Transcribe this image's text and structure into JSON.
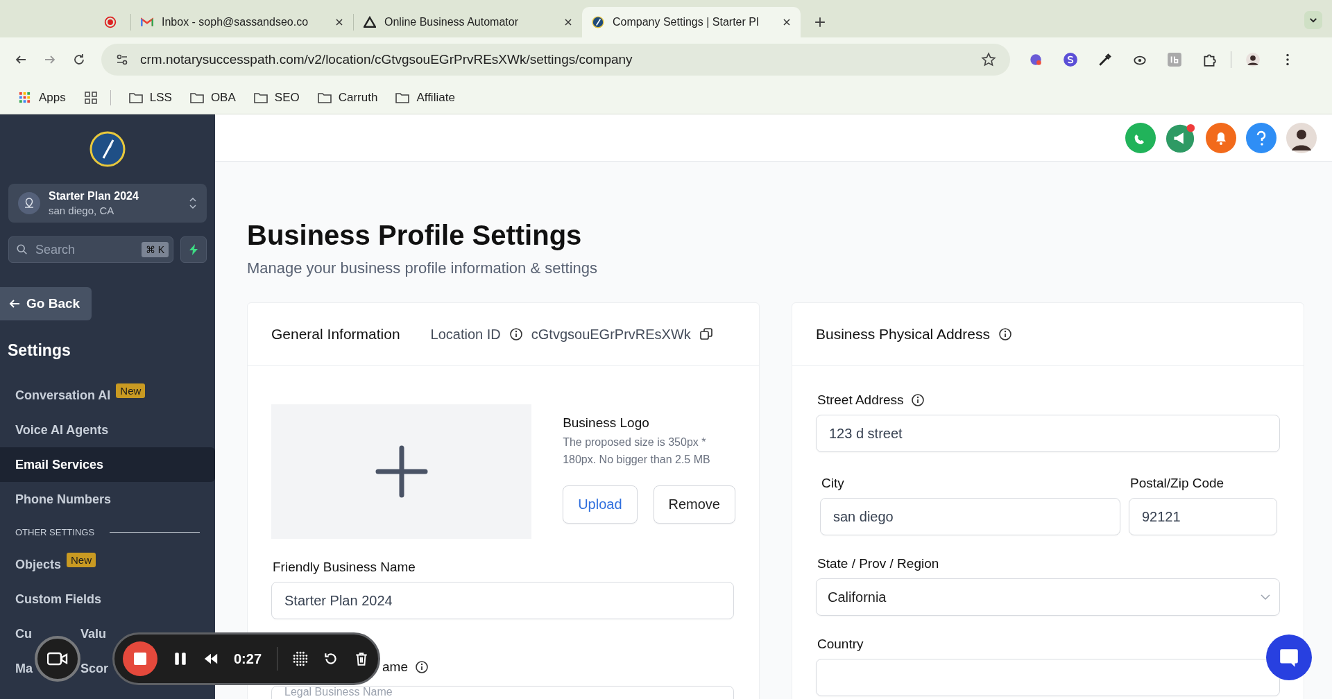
{
  "browser": {
    "tabs": [
      {
        "kind": "record",
        "selected": false
      },
      {
        "kind": "mail",
        "title": "Inbox - soph@sassandseo.co",
        "selected": false
      },
      {
        "kind": "triangle",
        "title": "Online Business Automator",
        "selected": false
      },
      {
        "kind": "compass",
        "title": "Company Settings | Starter Pl",
        "selected": true
      }
    ],
    "url": "crm.notarysuccesspath.com/v2/location/cGtvgsouEGrPrvREsXWk/settings/company",
    "bookmarks": [
      {
        "kind": "apps",
        "label": "Apps"
      },
      {
        "kind": "grid"
      },
      {
        "kind": "folder",
        "label": "LSS"
      },
      {
        "kind": "folder",
        "label": "OBA"
      },
      {
        "kind": "folder",
        "label": "SEO"
      },
      {
        "kind": "folder",
        "label": "Carruth"
      },
      {
        "kind": "folder",
        "label": "Affiliate"
      }
    ]
  },
  "sidebar": {
    "account": {
      "name": "Starter Plan 2024",
      "location": "san diego, CA"
    },
    "search": {
      "placeholder": "Search",
      "shortcut": "⌘ K"
    },
    "back": "Go Back",
    "heading": "Settings",
    "items": [
      {
        "kind": "link",
        "label": "Conversation AI",
        "badge": "New",
        "selected": false
      },
      {
        "kind": "link",
        "label": "Voice AI Agents",
        "selected": false
      },
      {
        "kind": "link",
        "label": "Email Services",
        "selected": true
      },
      {
        "kind": "link",
        "label": "Phone Numbers",
        "selected": false
      },
      {
        "kind": "section",
        "label": "OTHER SETTINGS"
      },
      {
        "kind": "link",
        "label": "Objects",
        "badge": "New",
        "selected": false
      },
      {
        "kind": "link",
        "label": "Custom Fields",
        "selected": false
      },
      {
        "kind": "covered",
        "parts": [
          "Cu",
          "Valu"
        ],
        "selected": false
      },
      {
        "kind": "covered",
        "parts": [
          "Ma",
          "Scor"
        ],
        "selected": false
      }
    ]
  },
  "header": {
    "notification_dot": true
  },
  "page": {
    "title": "Business Profile Settings",
    "subtitle": "Manage your business profile information & settings",
    "general": {
      "title": "General Information",
      "location_label": "Location ID",
      "location_id": "cGtvgsouEGrPrvREsXWk",
      "logo_title": "Business Logo",
      "logo_hint": "The proposed size is 350px * 180px. No bigger than 2.5 MB",
      "buttons": [
        {
          "kind": "primary",
          "label": "Upload"
        },
        {
          "kind": "plain",
          "label": "Remove"
        }
      ],
      "fields": [
        {
          "kind": "text",
          "label": "Friendly Business Name",
          "value": "Starter Plan 2024"
        },
        {
          "kind": "covered",
          "label": "ame",
          "placeholder": "Legal Business Name",
          "info": true
        }
      ]
    },
    "address": {
      "title": "Business Physical Address",
      "rows": [
        [
          {
            "kind": "text",
            "label": "Street Address",
            "info": true,
            "value": "123 d street"
          }
        ],
        [
          {
            "kind": "text",
            "label": "City",
            "value": "san diego"
          },
          {
            "kind": "text",
            "label": "Postal/Zip Code",
            "value": "92121"
          }
        ],
        [
          {
            "kind": "select",
            "label": "State / Prov / Region",
            "value": "California"
          }
        ],
        [
          {
            "kind": "text",
            "label": "Country"
          }
        ]
      ]
    }
  },
  "recorder": {
    "time": "0:27"
  }
}
